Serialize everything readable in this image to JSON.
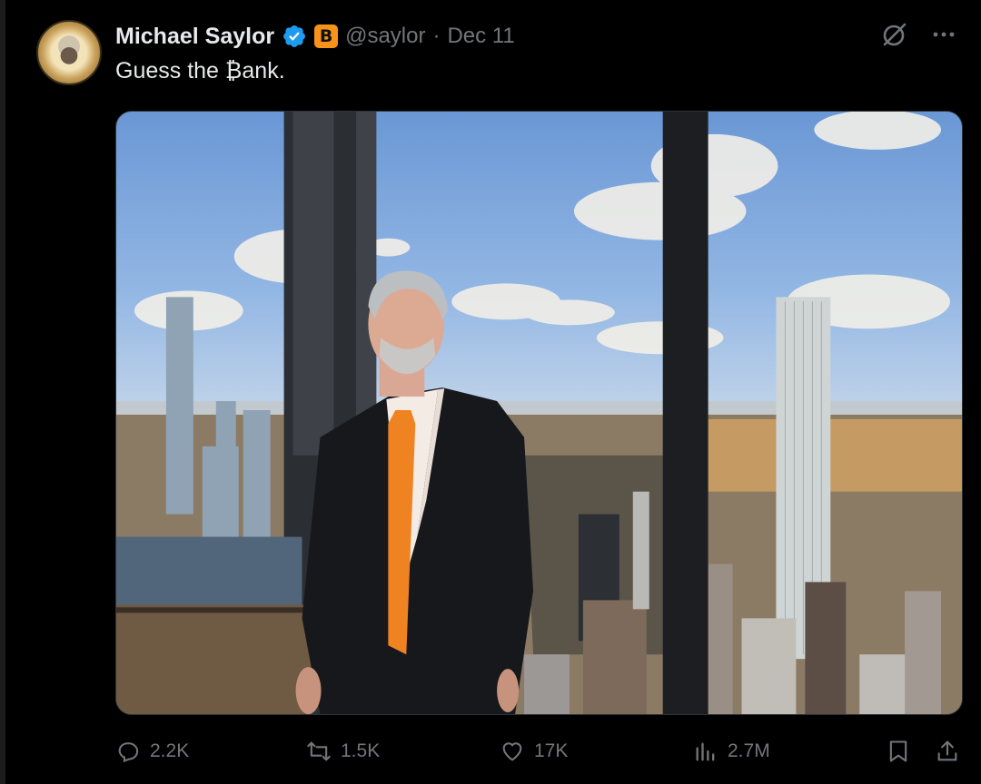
{
  "post": {
    "author_name": "Michael Saylor",
    "badge_symbol": "B",
    "handle": "@saylor",
    "separator": "·",
    "date": "Dec 11",
    "text": "Guess the ₿ank."
  },
  "stats": {
    "replies": "2.2K",
    "reposts": "1.5K",
    "likes": "17K",
    "views": "2.7M"
  },
  "icons": {
    "verified": "verified-badge-icon",
    "grok": "grok-icon",
    "more": "more-icon",
    "reply": "reply-icon",
    "repost": "repost-icon",
    "like": "heart-icon",
    "views": "views-icon",
    "bookmark": "bookmark-icon",
    "share": "share-icon"
  },
  "colors": {
    "background": "#000000",
    "accent": "#1d9bf0",
    "badge": "#f7931a",
    "muted": "#71767b"
  }
}
